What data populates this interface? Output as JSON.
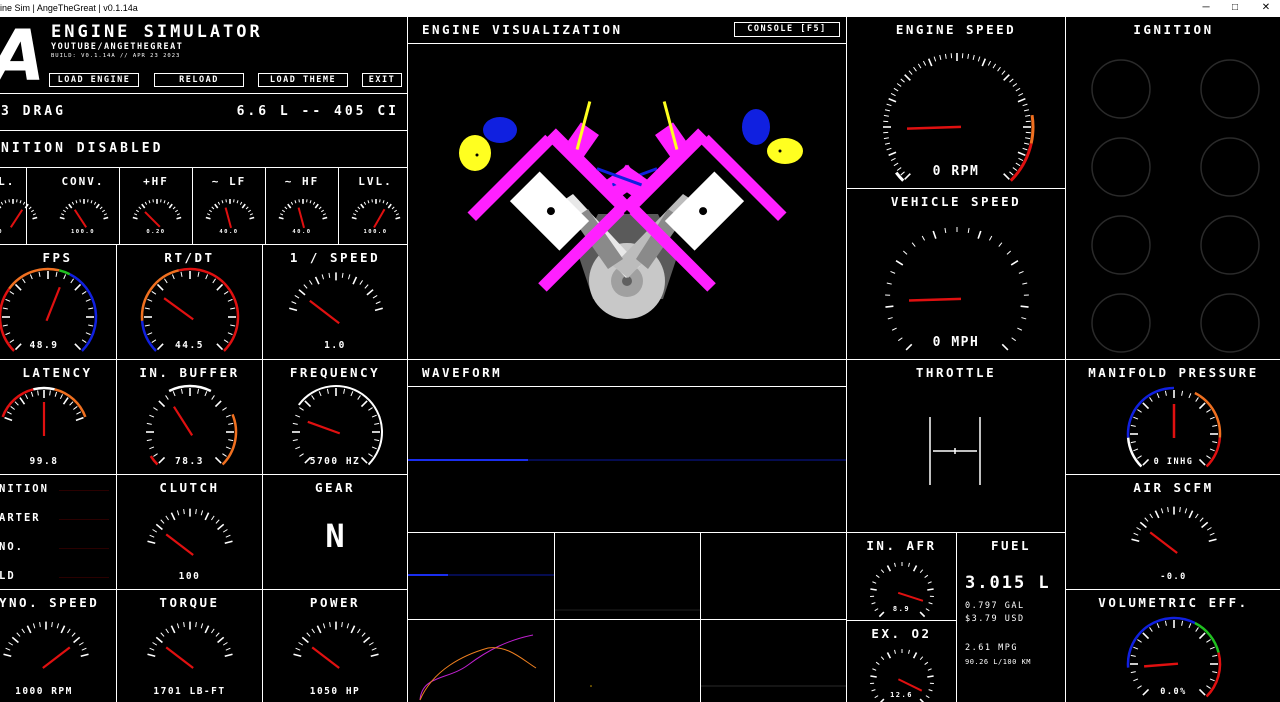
{
  "window": {
    "title": "ine Sim | AngeTheGreat | v0.1.14a",
    "minimize": "─",
    "maximize": "□",
    "close": "✕"
  },
  "header": {
    "logo": "A",
    "title": "ENGINE SIMULATOR",
    "subtitle": "YOUTUBE/ANGETHEGREAT",
    "build": "BUILD: V0.1.14A // APR 23 2023",
    "buttons": {
      "load_engine": "LOAD ENGINE",
      "reload": "RELOAD",
      "load_theme": "LOAD THEME",
      "exit": "EXIT"
    }
  },
  "engine_info": {
    "name": "3 DRAG",
    "displacement": "6.6 L -- 405 CI",
    "ignition_status": "NITION DISABLED"
  },
  "mini_gauges": [
    {
      "label": "OL.",
      "value": "100.0",
      "needle": 0.72
    },
    {
      "label": "CONV.",
      "value": "100.0",
      "needle": 0.28
    },
    {
      "label": "+HF",
      "value": "0.20",
      "needle": 0.2
    },
    {
      "label": "~ LF",
      "value": "40.0",
      "needle": 0.4
    },
    {
      "label": "~ HF",
      "value": "40.0",
      "needle": 0.4
    },
    {
      "label": "LVL.",
      "value": "100.0",
      "needle": 0.7
    }
  ],
  "gauges": {
    "fps": {
      "label": "FPS",
      "value": "48.9",
      "needle": 0.58
    },
    "rtdt": {
      "label": "RT/DT",
      "value": "44.5",
      "needle": 0.3
    },
    "inv_speed": {
      "label": "1 / SPEED",
      "value": "1.0",
      "needle": 0.15
    },
    "latency": {
      "label": "LATENCY",
      "value": "99.8",
      "needle": 0.5
    },
    "in_buffer": {
      "label": "IN. BUFFER",
      "value": "78.3",
      "needle": 0.38
    },
    "frequency": {
      "label": "FREQUENCY",
      "value": "5700 HZ",
      "needle": 0.24
    },
    "clutch": {
      "label": "CLUTCH",
      "value": "100",
      "needle": 0.15
    },
    "dyno_speed": {
      "label": "YNO. SPEED",
      "value": "1000 RPM",
      "needle": 0.85
    },
    "torque": {
      "label": "TORQUE",
      "value": "1701 LB-FT",
      "needle": 0.15
    },
    "power": {
      "label": "POWER",
      "value": "1050 HP",
      "needle": 0.15
    },
    "engine_speed": {
      "label": "ENGINE SPEED",
      "value": "0 RPM",
      "needle": 0.16
    },
    "vehicle_speed": {
      "label": "VEHICLE SPEED",
      "value": "0 MPH",
      "needle": 0.16
    },
    "manifold_pressure": {
      "label": "MANIFOLD PRESSURE",
      "value": "0 INHG",
      "needle": 0.5
    },
    "air_scfm": {
      "label": "AIR SCFM",
      "value": "-0.0",
      "needle": 0.15
    },
    "volumetric_eff": {
      "label": "VOLUMETRIC EFF.",
      "value": "0.0%",
      "needle": 0.15
    },
    "in_afr": {
      "label": "IN. AFR",
      "value": "8.9",
      "needle": 0.9
    },
    "ex_o2": {
      "label": "EX. O2",
      "value": "12.6",
      "needle": 0.93
    }
  },
  "starter_panel": {
    "labels": [
      "NITION",
      "ARTER",
      "NO.",
      "LD"
    ]
  },
  "gear": {
    "label": "GEAR",
    "value": "N"
  },
  "engine_vis": {
    "title": "ENGINE VISUALIZATION",
    "console_button": "CONSOLE [F5]"
  },
  "waveform": {
    "title": "WAVEFORM"
  },
  "throttle": {
    "label": "THROTTLE"
  },
  "ignition": {
    "label": "IGNITION"
  },
  "fuel": {
    "label": "FUEL",
    "volume": "3.015 L",
    "gal": "0.797 GAL",
    "cost": "$3.79 USD",
    "mpg": "2.61 MPG",
    "l100": "90.26 L/100 KM"
  },
  "colors": {
    "needle": "#e01010",
    "accent_orange": "#f07020",
    "accent_blue": "#1020e0",
    "accent_green": "#20c020",
    "magenta": "#ff20ff",
    "yellow": "#ffff20"
  }
}
